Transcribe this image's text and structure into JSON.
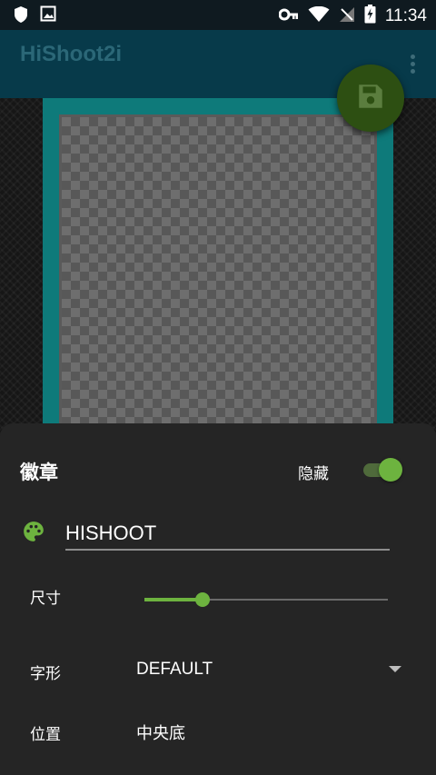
{
  "status_bar": {
    "time": "11:34",
    "icons": [
      "shield-icon",
      "image-icon",
      "key-icon",
      "wifi-icon",
      "no-signal-icon",
      "battery-charging-icon"
    ]
  },
  "app_bar": {
    "title": "HiShoot2i",
    "menu_icon": "overflow-menu-icon"
  },
  "fab": {
    "icon": "save-icon",
    "color": "#2d4f12"
  },
  "sheet": {
    "title": "徽章",
    "hide_label": "隐藏",
    "hide_switch_on": true,
    "badge_text": "HISHOOT",
    "palette_icon": "palette-icon",
    "size_label": "尺寸",
    "size_value_fraction": 0.24,
    "font_label": "字形",
    "font_value": "DEFAULT",
    "position_label": "位置",
    "position_value": "中央底"
  },
  "colors": {
    "accent": "#6db33f",
    "app_bar": "#073a4a",
    "frame": "#0e7a7a",
    "sheet": "#252525"
  }
}
